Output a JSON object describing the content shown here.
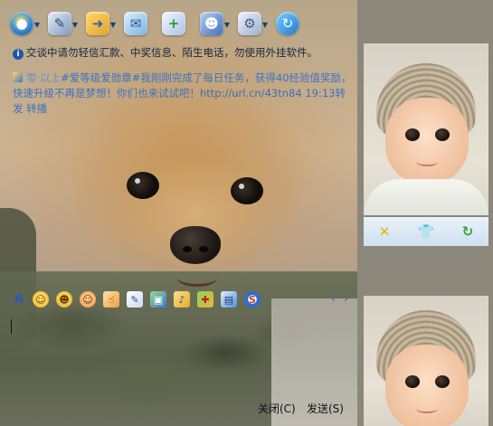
{
  "toolbar": {
    "items": [
      {
        "name": "video-call",
        "icon": "camera-icon",
        "glyph": "●"
      },
      {
        "name": "voice-call",
        "icon": "microphone-icon",
        "glyph": "✎"
      },
      {
        "name": "send-file",
        "icon": "folder-icon",
        "glyph": "➜"
      },
      {
        "name": "send-mail",
        "icon": "mail-icon",
        "glyph": "✉"
      },
      {
        "name": "create-discussion",
        "icon": "add-note-icon",
        "glyph": "+"
      },
      {
        "name": "user-info",
        "icon": "user-icon",
        "glyph": "☻"
      },
      {
        "name": "settings",
        "icon": "gear-icon",
        "glyph": "⚙"
      },
      {
        "name": "share",
        "icon": "share-icon",
        "glyph": "↻"
      }
    ]
  },
  "notice": {
    "text": "交谈中请勿轻信汇款、中奖信息、陌生电话，勿使用外挂软件。"
  },
  "system_message": {
    "sender": "零·以上",
    "content": "#爱等级爱勋章#我刚刚完成了每日任务，获得40经验值奖励，快速升级不再是梦想！你们也来试试吧！",
    "link": "http://url.cn/43tn84",
    "time": "19:13",
    "time_suffix": "转发",
    "action": "转播"
  },
  "format_bar": {
    "items": [
      "font",
      "emoticon",
      "wink",
      "magic-face",
      "thumb",
      "edit",
      "image",
      "music",
      "gift",
      "screenshot",
      "payment"
    ],
    "prev": "‹",
    "next": "›"
  },
  "input": {
    "value": ""
  },
  "buttons": {
    "close": "关闭(C)",
    "send": "发送(S)"
  },
  "sidebar_tools": {
    "items": [
      "remove",
      "outfit",
      "refresh"
    ]
  },
  "colors": {
    "link": "#3a72c4",
    "notice_icon": "#1d58a8",
    "side_bg": "#8b877b"
  }
}
